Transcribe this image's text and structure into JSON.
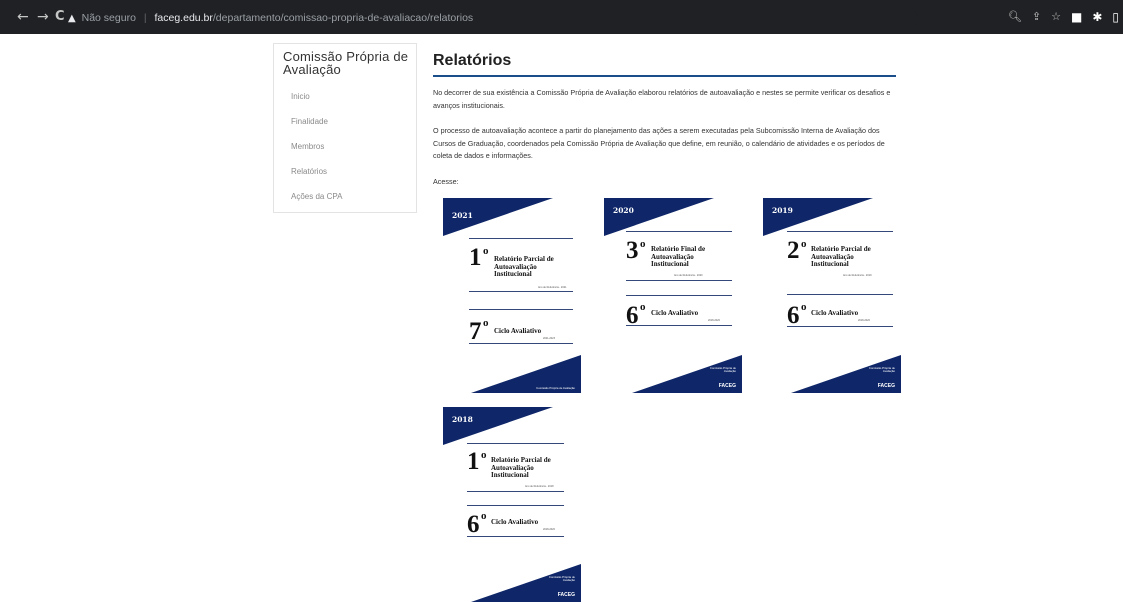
{
  "browser": {
    "back_icon": "←",
    "forward_icon": "→",
    "reload_icon": "C",
    "warning_icon": "▲",
    "insecure_label": "Não seguro",
    "separator": "|",
    "domain": "faceg.edu.br",
    "path": "/departamento/comissao-propria-de-avaliacao/relatorios",
    "tools": [
      "🔍︎",
      "⇪",
      "☆",
      "■",
      "✱",
      "▯"
    ]
  },
  "sidebar": {
    "title": "Comissão Própria de Avaliação",
    "items": [
      {
        "label": "Inicio"
      },
      {
        "label": "Finalidade"
      },
      {
        "label": "Membros"
      },
      {
        "label": "Relatórios"
      },
      {
        "label": "Ações da CPA"
      }
    ]
  },
  "main": {
    "title": "Relatórios",
    "paragraphs": [
      "No decorrer de sua existência a Comissão Própria de Avaliação elaborou relatórios de autoavaliação e nestes se permite verificar os desafios e avanços institucionais.",
      "O processo de autoavaliação acontece a partir do planejamento das ações a serem executadas pela Subcomissão Interna de Avaliação dos Cursos de Graduação, coordenados pela Comissão Própria de Avaliação que define, em reunião, o calendário de atividades e os períodos de coleta de dados e informações."
    ],
    "access_label": "Acesse:"
  },
  "reports": [
    {
      "year": "2021",
      "number": "1",
      "sup": "o",
      "title": "Relatório Parcial de Autoavaliação Institucional",
      "ref_note": "Ano de Referência - 2021",
      "cycle_number": "7",
      "cycle_sup": "o",
      "cycle_label": "Ciclo Avaliativo",
      "cycle_years": "2021-2023",
      "footer": "Comissão Própria de Avaliação",
      "logo": ""
    },
    {
      "year": "2020",
      "number": "3",
      "sup": "o",
      "title": "Relatório Final de Autoavaliação Institucional",
      "ref_note": "Ano de Referência - 2020",
      "cycle_number": "6",
      "cycle_sup": "o",
      "cycle_label": "Ciclo Avaliativo",
      "cycle_years": "2018-2020",
      "footer": "Comissão Própria de Avaliação",
      "logo": "FACEG"
    },
    {
      "year": "2019",
      "number": "2",
      "sup": "o",
      "title": "Relatório Parcial de Autoavaliação Institucional",
      "ref_note": "Ano de Referência - 2019",
      "cycle_number": "6",
      "cycle_sup": "o",
      "cycle_label": "Ciclo Avaliativo",
      "cycle_years": "2018-2020",
      "footer": "Comissão Própria de Avaliação",
      "logo": "FACEG"
    },
    {
      "year": "2018",
      "number": "1",
      "sup": "o",
      "title": "Relatório Parcial de Autoavaliação Institucional",
      "ref_note": "Ano de Referência - 2018",
      "cycle_number": "6",
      "cycle_sup": "o",
      "cycle_label": "Ciclo Avaliativo",
      "cycle_years": "2018-2020",
      "footer": "Comissão Própria de Avaliação",
      "logo": "FACEG"
    }
  ],
  "colors": {
    "cover_navy": "#0f2769",
    "title_rule": "#1a4e8a",
    "chrome_bg": "#202124"
  }
}
